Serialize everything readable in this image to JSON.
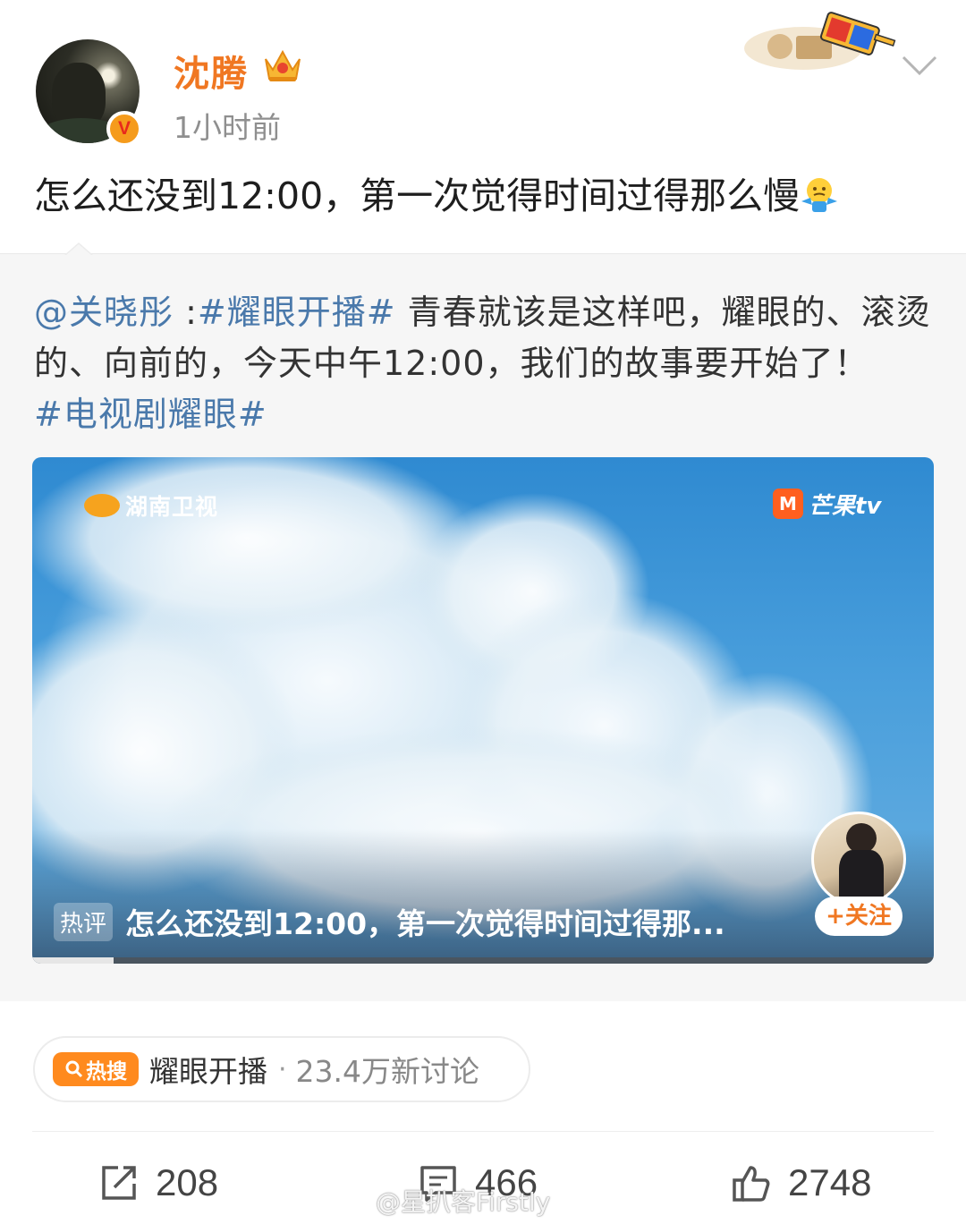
{
  "author": {
    "name": "沈腾",
    "time": "1小时前",
    "verified_mark": "V"
  },
  "post": {
    "text": "怎么还没到12:00，第一次觉得时间过得那么慢"
  },
  "repost": {
    "mention": "@关晓彤",
    "colon": " :",
    "topic1": "#耀眼开播#",
    "body": "  青春就该是这样吧，耀眼的、滚烫的、向前的，今天中午12:00，我们的故事要开始了！",
    "topic2": "#电视剧耀眼#"
  },
  "video": {
    "channel_logo": "湖南卫视",
    "platform_logo": "芒果tv",
    "platform_mark": "M",
    "hot_comment_tag": "热评",
    "hot_comment_text": "怎么还没到12:00，第一次觉得时间过得那...",
    "follow_label": "+关注",
    "progress": 0.09
  },
  "hot_search": {
    "badge": "热搜",
    "badge_icon": "search-icon",
    "topic": "耀眼开播",
    "separator": "·",
    "count": "23.4万新讨论"
  },
  "actions": {
    "reposts": "208",
    "comments": "466",
    "likes": "2748"
  },
  "watermark": "@星扒客Firstly",
  "colors": {
    "username": "#f07722",
    "topic": "#4a79ab",
    "hot_badge": "#ff8a1e"
  }
}
